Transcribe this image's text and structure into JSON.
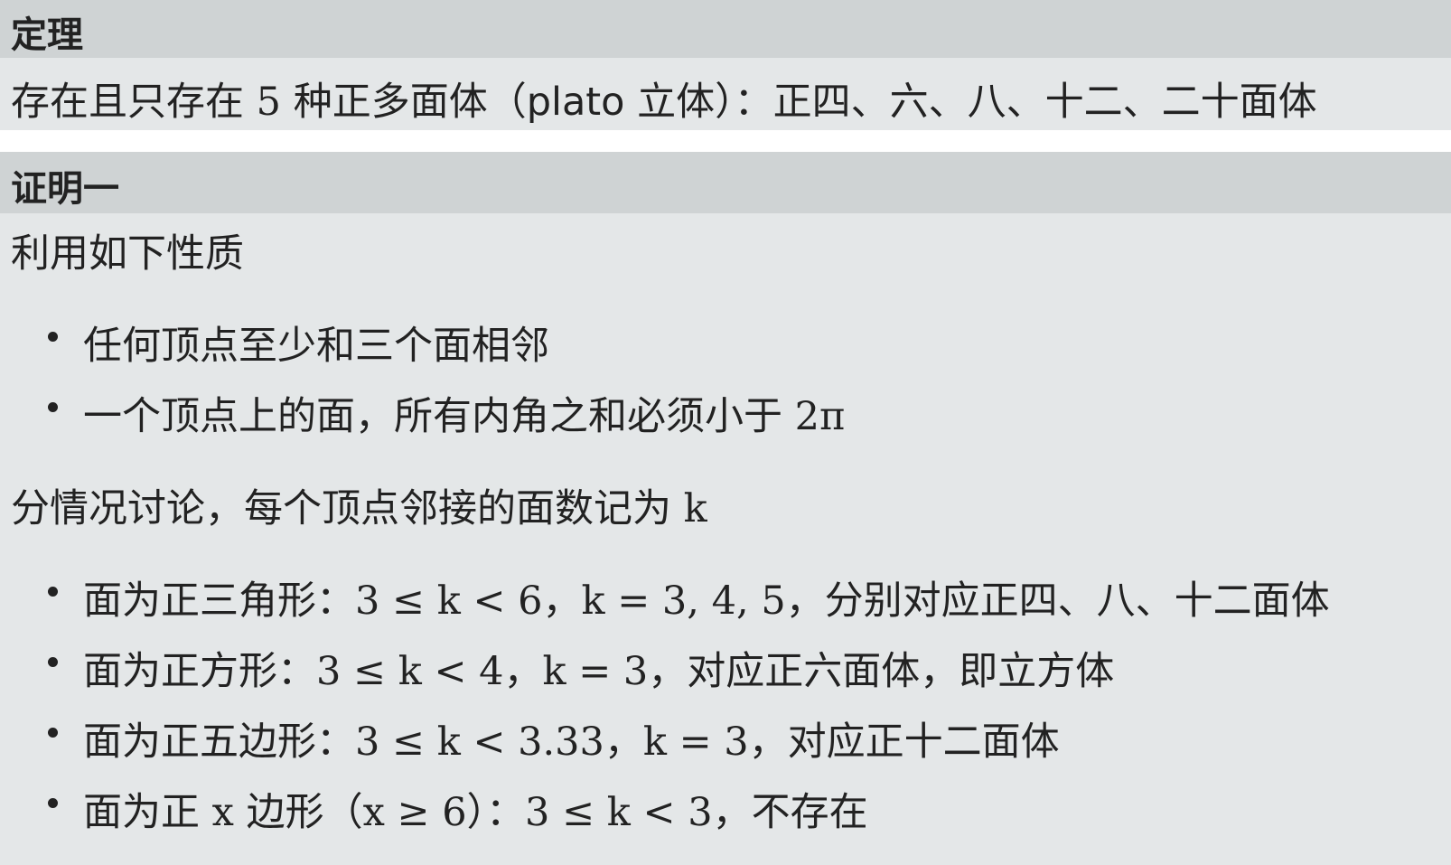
{
  "theorem": {
    "title": "定理",
    "text_prefix": "存在且只存在 5 种正多面体（",
    "text_plato": "plato",
    "text_suffix": " 立体）：正四、六、八、十二、二十面体"
  },
  "proof": {
    "title": "证明一",
    "intro": "利用如下性质",
    "properties": [
      "任何顶点至少和三个面相邻",
      "一个顶点上的面，所有内角之和必须小于 2π"
    ],
    "cases_intro": "分情况讨论，每个顶点邻接的面数记为 k",
    "cases": [
      "面为正三角形：3 ≤ k < 6，k = 3, 4, 5，分别对应正四、八、十二面体",
      "面为正方形：3 ≤ k < 4，k = 3，对应正六面体，即立方体",
      "面为正五边形：3 ≤ k < 3.33，k = 3，对应正十二面体",
      "面为正 x 边形（x ≥ 6）：3 ≤ k < 3，不存在"
    ]
  }
}
